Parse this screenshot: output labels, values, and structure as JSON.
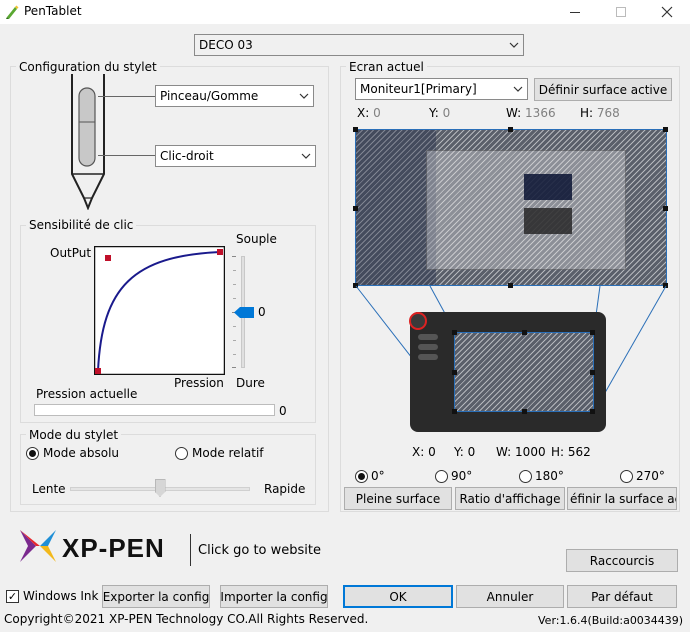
{
  "window": {
    "title": "PenTablet"
  },
  "device": {
    "selected": "DECO 03"
  },
  "stylus": {
    "group_label": "Configuration du stylet",
    "upper_button": "Pinceau/Gomme",
    "lower_button": "Clic-droit"
  },
  "sensitivity": {
    "group_label": "Sensibilité de clic",
    "output_label": "OutPut",
    "soft_label": "Souple",
    "hard_label": "Dure",
    "pressure_axis_label": "Pression",
    "slider_value": "0",
    "slider_level_fraction": 0.5,
    "current_pressure_label": "Pression actuelle",
    "current_pressure_value": "0"
  },
  "mode": {
    "group_label": "Mode du stylet",
    "absolute": "Mode absolu",
    "relative": "Mode relatif",
    "selected": "absolute",
    "slow_label": "Lente",
    "fast_label": "Rapide",
    "speed_fraction": 0.5
  },
  "screen": {
    "group_label": "Ecran actuel",
    "monitor": "Moniteur1[Primary]",
    "define_button": "Définir surface active",
    "x_label": "X:",
    "x": "0",
    "y_label": "Y:",
    "y": "0",
    "w_label": "W:",
    "w": "1366",
    "h_label": "H:",
    "h": "768"
  },
  "tablet": {
    "x_label": "X:",
    "x": "0",
    "y_label": "Y:",
    "y": "0",
    "w_label": "W:",
    "w": "1000",
    "h_label": "H:",
    "h": "562"
  },
  "rotation": {
    "options": [
      "0°",
      "90°",
      "180°",
      "270°"
    ],
    "selected": "0°"
  },
  "area_buttons": {
    "full": "Pleine surface",
    "ratio": "Ratio d'affichage",
    "define": "éfinir la surface activ"
  },
  "brand": {
    "name": "XP-PEN",
    "link": "Click go to website"
  },
  "bottom": {
    "shortcuts": "Raccourcis",
    "windows_ink": "Windows Ink",
    "windows_ink_checked": true,
    "export": "Exporter la config",
    "import": "Importer la config",
    "ok": "OK",
    "cancel": "Annuler",
    "default": "Par défaut",
    "copyright": "Copyright©2021  XP-PEN Technology CO.All Rights Reserved.",
    "version": "Ver:1.6.4(Build:a0034439)"
  },
  "colors": {
    "accent_blue": "#0078d7",
    "curve_blue": "#1a1a8c",
    "curve_point_red": "#c0102a",
    "brand_red": "#e8262c",
    "brand_purple": "#7b2a8e",
    "brand_blue": "#1f8fd6"
  },
  "icons": {
    "app": "pen-tablet-icon",
    "dropdown": "chevron-down-icon",
    "minimize": "minimize-icon",
    "maximize": "maximize-icon",
    "close": "close-icon",
    "logo": "xp-pen-logo-icon"
  }
}
